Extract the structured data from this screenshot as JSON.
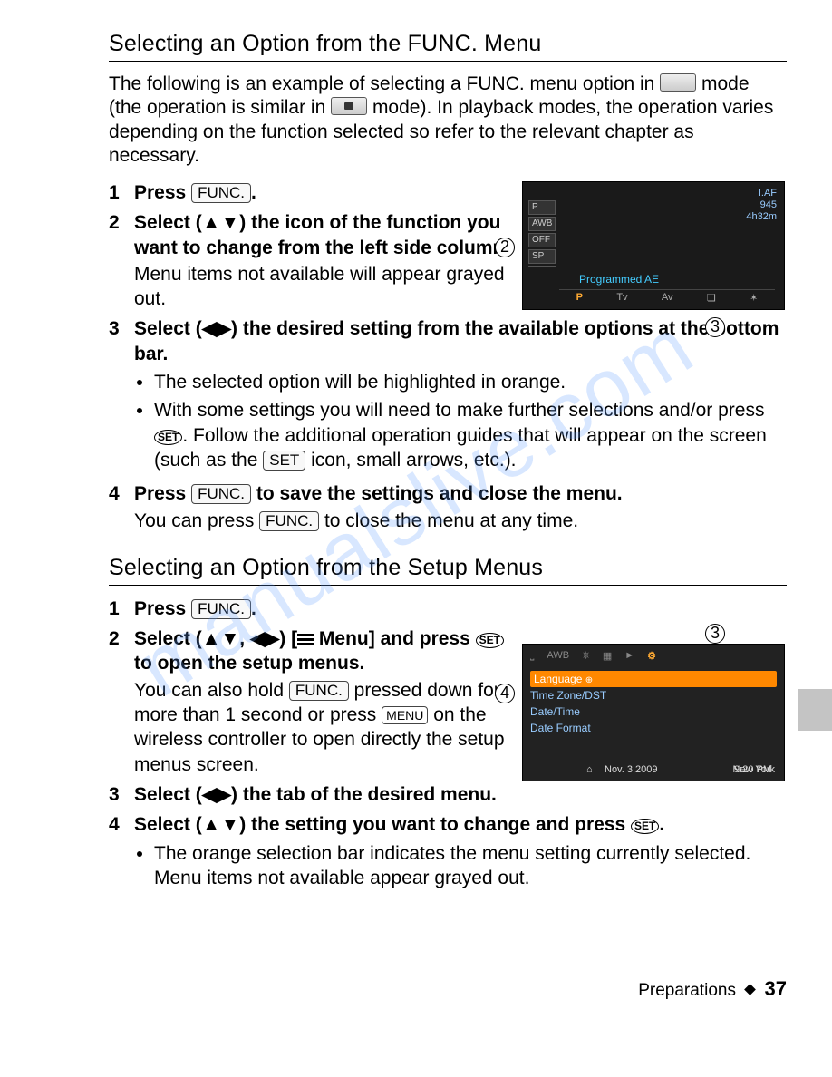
{
  "section1": {
    "title": "Selecting an Option from the FUNC. Menu",
    "intro_part1": "The following is an example of selecting a FUNC. menu option in ",
    "intro_part2": " mode (the operation is similar in ",
    "intro_part3": " mode). In playback modes, the operation varies depending on the function selected so refer to the relevant chapter as necessary.",
    "step1_num": "1",
    "step1_label": "Press ",
    "step1_end": ".",
    "step2_num": "2",
    "step2_primary_a": "Select (",
    "step2_primary_arrows": "▲▼",
    "step2_primary_b": ") the icon of the function you want to change from the left side column.",
    "step2_secondary": "Menu items not available will appear grayed out.",
    "step3_num": "3",
    "step3_primary_a": "Select (",
    "step3_primary_arrows": "◀▶",
    "step3_primary_b": ") the desired setting from the available options at the bottom bar.",
    "step3_bullet1": "The selected option will be highlighted in orange.",
    "step3_bullet2_a": "With some settings you will need to make further selections and/or press ",
    "step3_bullet2_b": ". Follow the additional operation guides that will appear on the screen (such as the ",
    "step3_bullet2_c": " icon, small arrows, etc.).",
    "step4_num": "4",
    "step4_primary_a": "Press ",
    "step4_primary_b": " to save the settings and close the menu.",
    "step4_secondary_a": "You can press ",
    "step4_secondary_b": " to close the menu at any time."
  },
  "section2": {
    "title": "Selecting an Option from the Setup Menus",
    "step1_num": "1",
    "step1_label": "Press ",
    "step1_end": ".",
    "step2_num": "2",
    "step2_primary_a": "Select (",
    "step2_primary_arr1": "▲▼",
    "step2_primary_mid": ", ",
    "step2_primary_arr2": "◀▶",
    "step2_primary_b": ") [",
    "step2_primary_menu": " Menu] and press ",
    "step2_primary_c": " to open the setup menus.",
    "step2_secondary_a": "You can also hold ",
    "step2_secondary_b": " pressed down for more than 1 second or press ",
    "step2_secondary_c": " on the wireless controller to open directly the setup menus screen.",
    "step3_num": "3",
    "step3_primary_a": "Select (",
    "step3_primary_arrows": "◀▶",
    "step3_primary_b": ") the tab of the desired menu.",
    "step4_num": "4",
    "step4_primary_a": "Select (",
    "step4_primary_arrows": "▲▼",
    "step4_primary_b": ") the setting you want to change and press ",
    "step4_primary_c": ".",
    "step4_bullet1": "The orange selection bar indicates the menu setting currently selected. Menu items not available appear grayed out."
  },
  "labels": {
    "func": "FUNC.",
    "set": "SET",
    "set_icon": "SET",
    "menu": "MENU"
  },
  "screenshot1": {
    "af": "I.AF",
    "count": "945",
    "time": "4h32m",
    "left": [
      "P",
      "AWB",
      "OFF",
      "SP",
      ""
    ],
    "mode_label": "Programmed AE",
    "bottom": [
      "P",
      "Tv",
      "Av",
      "❏",
      "✶"
    ]
  },
  "callouts": {
    "c2": "2",
    "c3": "3",
    "c3b": "3",
    "c4": "4"
  },
  "screenshot2": {
    "tabs": [
      "",
      "AW",
      "",
      "",
      "",
      ""
    ],
    "items": [
      "Language",
      "Time Zone/DST",
      "Date/Time",
      "Date Format"
    ],
    "home_icon": "⌂",
    "city": "New York",
    "date": "Nov. 3,2009",
    "clock": "9:20 PM"
  },
  "footer": {
    "chapter": "Preparations",
    "page": "37"
  },
  "watermark": "manualslive.com"
}
